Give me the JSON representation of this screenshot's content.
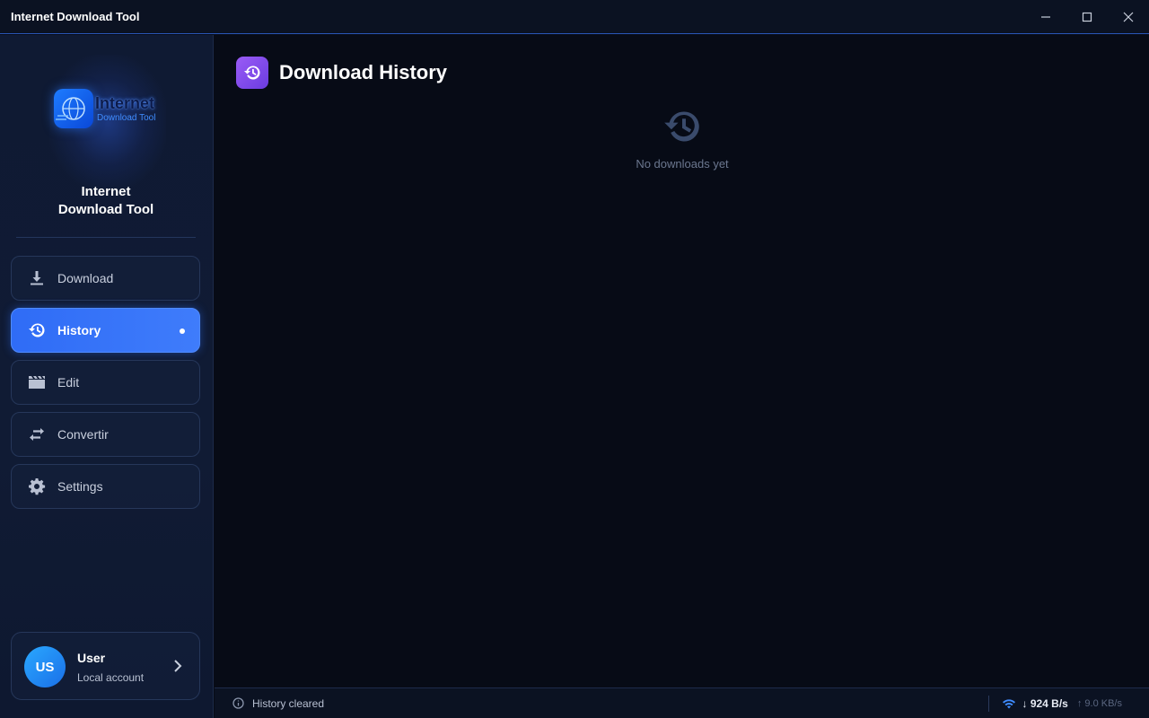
{
  "window": {
    "title": "Internet Download Tool"
  },
  "sidebar": {
    "logo": {
      "word1": "Internet",
      "word2": "Download Tool"
    },
    "brand_line1": "Internet",
    "brand_line2": "Download Tool",
    "items": [
      {
        "label": "Download",
        "icon": "download-icon",
        "active": false
      },
      {
        "label": "History",
        "icon": "history-icon",
        "active": true
      },
      {
        "label": "Edit",
        "icon": "clapperboard-icon",
        "active": false
      },
      {
        "label": "Convertir",
        "icon": "swap-arrows-icon",
        "active": false
      },
      {
        "label": "Settings",
        "icon": "gear-icon",
        "active": false
      }
    ],
    "user": {
      "initials": "US",
      "name": "User",
      "role": "Local account"
    }
  },
  "main": {
    "title": "Download History",
    "title_icon": "history-icon",
    "empty_text": "No downloads yet"
  },
  "statusbar": {
    "message": "History cleared",
    "download_speed": "↓ 924 B/s",
    "upload_speed": "↑ 9.0 KB/s"
  },
  "colors": {
    "accent": "#2f6cf6",
    "title_icon_bg": "#8a50f0",
    "background": "#070b16",
    "sidebar": "#0f1a33"
  }
}
